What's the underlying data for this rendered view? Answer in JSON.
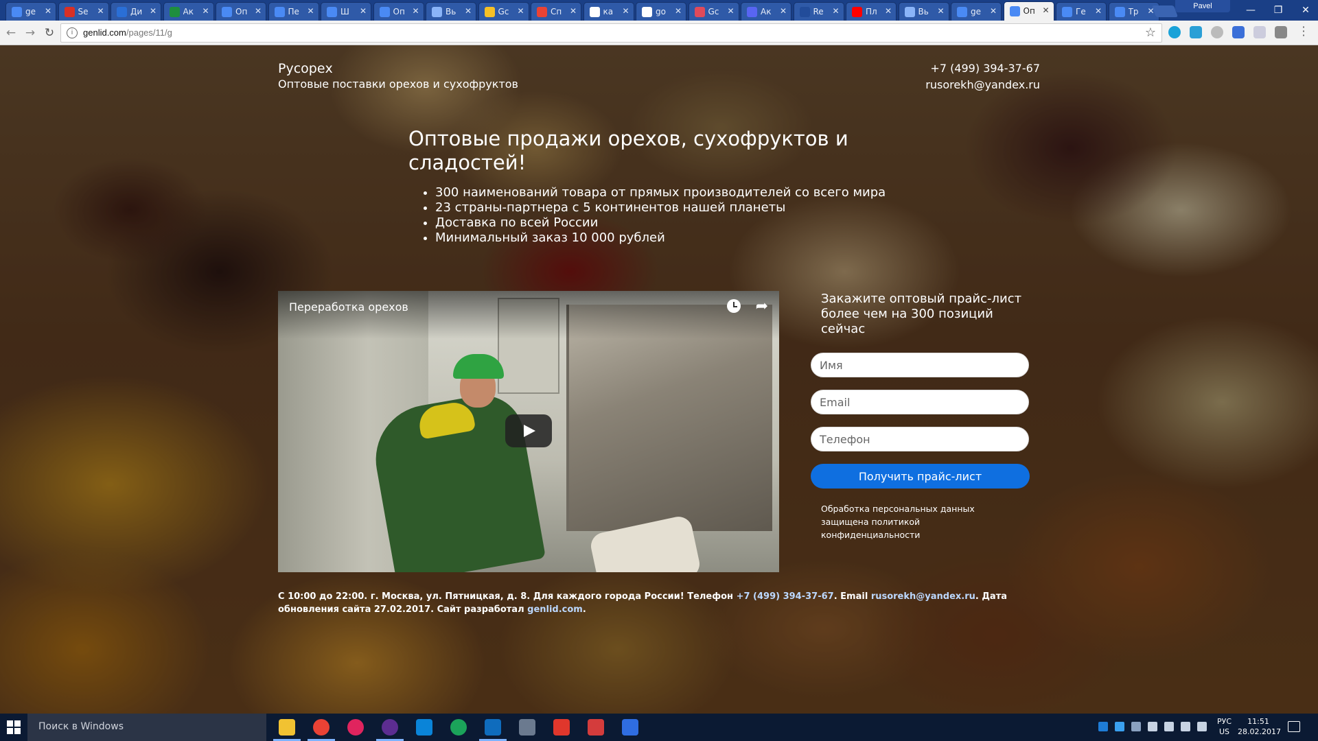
{
  "browser": {
    "tabs": [
      {
        "title": "ge",
        "color": "#4a8af4",
        "active": false
      },
      {
        "title": "Se",
        "color": "#d93025",
        "active": false
      },
      {
        "title": "Ди",
        "color": "#2a6fd6",
        "active": false
      },
      {
        "title": "Ак",
        "color": "#1e8e3e",
        "active": false
      },
      {
        "title": "Оп",
        "color": "#4a8af4",
        "active": false
      },
      {
        "title": "Пе",
        "color": "#4a8af4",
        "active": false
      },
      {
        "title": "Ш",
        "color": "#4a8af4",
        "active": false
      },
      {
        "title": "Оп",
        "color": "#4a8af4",
        "active": false
      },
      {
        "title": "Вь",
        "color": "#8ab4f8",
        "active": false
      },
      {
        "title": "Gc",
        "color": "#f6c026",
        "active": false
      },
      {
        "title": "Сп",
        "color": "#ea4335",
        "active": false
      },
      {
        "title": "ка",
        "color": "#ffffff",
        "active": false
      },
      {
        "title": "go",
        "color": "#ffffff",
        "active": false
      },
      {
        "title": "Gc",
        "color": "#e04a5a",
        "active": false
      },
      {
        "title": "Ак",
        "color": "#5865f2",
        "active": false
      },
      {
        "title": "Re",
        "color": "#224c9a",
        "active": false
      },
      {
        "title": "Пл",
        "color": "#ff0000",
        "active": false
      },
      {
        "title": "Вь",
        "color": "#8ab4f8",
        "active": false
      },
      {
        "title": "ge",
        "color": "#4a8af4",
        "active": false
      },
      {
        "title": "Оп",
        "color": "#4a8af4",
        "active": true
      },
      {
        "title": "Ге",
        "color": "#4a8af4",
        "active": false
      },
      {
        "title": "Тр",
        "color": "#4a8af4",
        "active": false
      }
    ],
    "profile_name": "Pavel",
    "url_host": "genlid.com",
    "url_path": "/pages/11/g"
  },
  "site": {
    "brand_name": "Русорех",
    "brand_tagline": "Оптовые поставки орехов и сухофруктов",
    "phone": "+7 (499) 394-37-67",
    "email": "rusorekh@yandex.ru",
    "headline": "Оптовые продажи орехов, сухофруктов и сладостей!",
    "benefits": [
      "300 наименований товара от прямых производителей со всего мира",
      "23 страны-партнера с 5 континентов нашей планеты",
      "Доставка по всей России",
      "Минимальный заказ 10 000 рублей"
    ],
    "video_title": "Переработка орехов",
    "form": {
      "title": "Закажите оптовый прайс-лист более чем на 300 позиций сейчас",
      "name_placeholder": "Имя",
      "email_placeholder": "Email",
      "phone_placeholder": "Телефон",
      "submit_label": "Получить прайс-лист",
      "privacy_note": "Обработка персональных данных защищена политикой конфиденциальности"
    },
    "footer": {
      "part1": "С 10:00 до 22:00. г. Москва, ул. Пятницкая, д. 8. Для каждого города России! Телефон ",
      "phone_link": "+7 (499) 394-37-67",
      "part2": ". Email ",
      "email_link": "rusorekh@yandex.ru",
      "part3": ". Дата обновления сайта 27.02.2017. Сайт разработал ",
      "dev_link": "genlid.com",
      "part4": "."
    }
  },
  "taskbar": {
    "search_placeholder": "Поиск в Windows",
    "lang_top": "РУС",
    "lang_bottom": "US",
    "time": "11:51",
    "date": "28.02.2017"
  },
  "colors": {
    "tabstrip": "#1a3f86",
    "submit_button": "#0f6fe0",
    "footer_link": "#bcd8ff"
  }
}
